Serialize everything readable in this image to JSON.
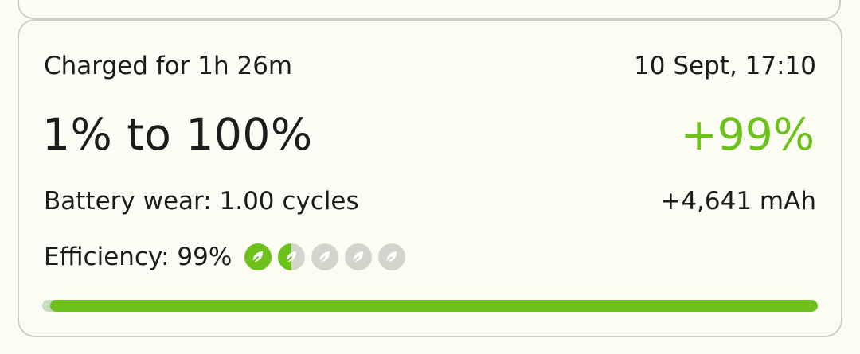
{
  "session": {
    "duration_text": "Charged for 1h 26m",
    "date_text": "10 Sept, 17:10",
    "range_text": "1% to 100%",
    "delta_text": "+99%",
    "wear_text": "Battery wear: 1.00 cycles",
    "mah_text": "+4,641 mAh",
    "efficiency_text": "Efficiency: 99%",
    "efficiency_rating": {
      "filled": 1.5,
      "total": 5,
      "icon": "leaf-icon"
    },
    "charge_start_fraction": 0.01,
    "charge_end_fraction": 1.0
  },
  "colors": {
    "accent": "#6cc21a",
    "leaf_inactive": "#d4d4cc",
    "border": "#cdcdc3",
    "background": "#fcfcf4",
    "track": "#c8dcc4"
  }
}
